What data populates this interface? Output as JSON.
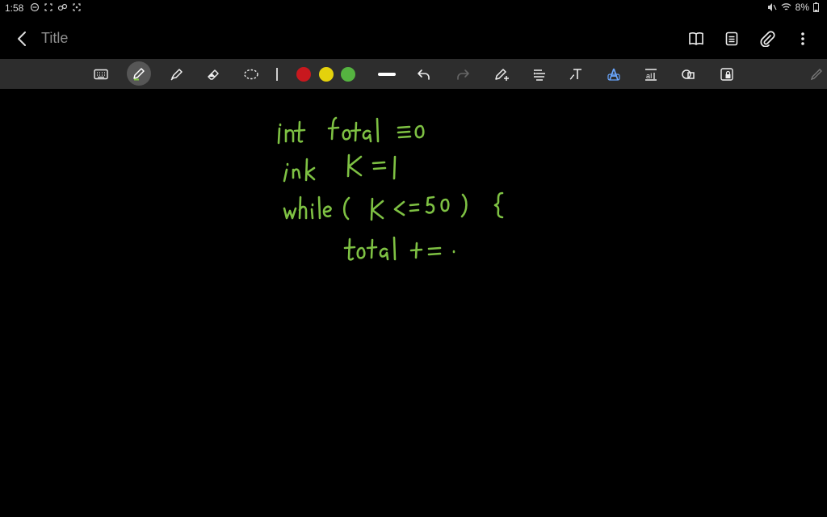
{
  "status": {
    "time": "1:58",
    "battery": "8%"
  },
  "appbar": {
    "title": "Title",
    "icons": [
      "back-chevron",
      "book",
      "page-list",
      "paperclip",
      "more-vertical"
    ]
  },
  "toolbar": {
    "tools": [
      "keyboard",
      "pen",
      "highlighter",
      "eraser",
      "lasso",
      "undo",
      "redo",
      "pen-plus",
      "text-align",
      "text-tool",
      "shape-ocr",
      "text-box",
      "shapes",
      "lock"
    ],
    "colors": [
      "#c8181e",
      "#e4d20c",
      "#55b340"
    ]
  },
  "note": {
    "ink_color": "#7ec143",
    "lines": [
      "int total = 0",
      "int K = 1",
      "while ( K <= 50 ) {",
      "total +="
    ]
  }
}
